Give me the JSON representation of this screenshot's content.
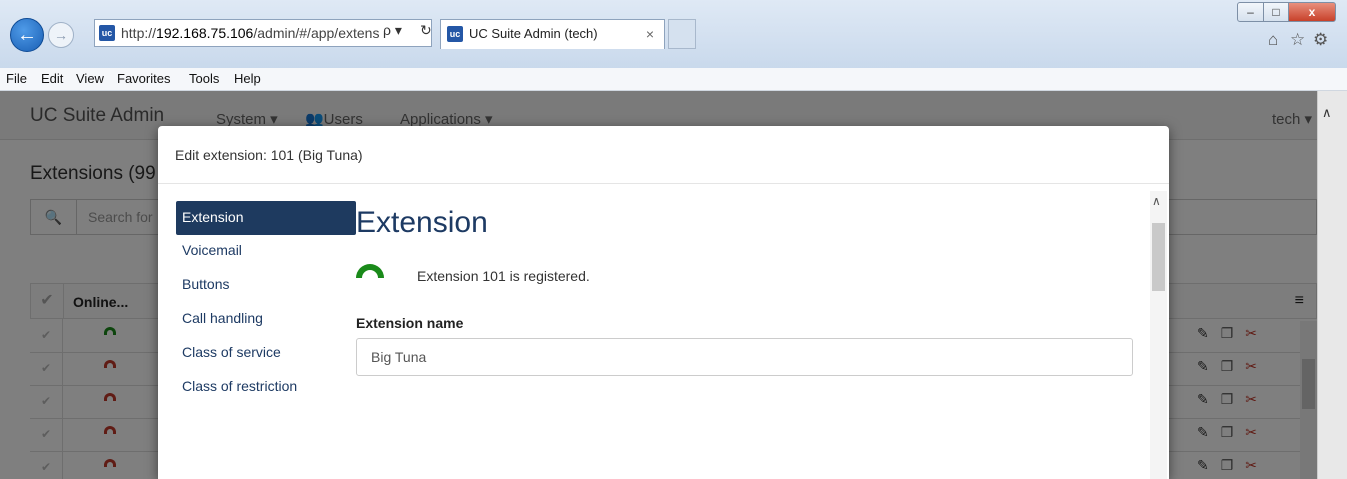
{
  "browser": {
    "url_prefix": "http://",
    "url_host": "192.168.75.106",
    "url_path": "/admin/#/app/extens",
    "search_glyph": "ρ ▾",
    "refresh_glyph": "↻",
    "tab_title": "UC Suite Admin (tech)",
    "tab_close": "×",
    "back_glyph": "←",
    "forward_glyph": "→",
    "home_glyph": "⌂",
    "favorites_glyph": "☆",
    "tools_glyph": "⚙",
    "min_glyph": "–",
    "max_glyph": "□",
    "close_glyph": "x",
    "favicon_text": "uc",
    "menu": [
      "File",
      "Edit",
      "View",
      "Favorites",
      "Tools",
      "Help"
    ]
  },
  "app": {
    "brand": "UC Suite Admin",
    "nav": [
      "System ▾",
      "👥Users",
      "Applications ▾"
    ],
    "user": "tech ▾",
    "page_title": "Extensions (99",
    "search_icon": "🔍",
    "search_placeholder": "Search for",
    "table_header_online": "Online...",
    "table_menu": "≡",
    "check_glyph": "✔",
    "rows": [
      {
        "status": "registered",
        "status_color": "#1a8a1a"
      },
      {
        "status": "unregistered",
        "status_color": "#c0392b"
      },
      {
        "status": "unregistered",
        "status_color": "#c0392b"
      },
      {
        "status": "unregistered",
        "status_color": "#c0392b"
      },
      {
        "status": "unregistered",
        "status_color": "#c0392b"
      }
    ],
    "row_actions": {
      "edit": "✎",
      "copy": "❐",
      "delete": "✂"
    }
  },
  "modal": {
    "title": "Edit extension: 101 (Big Tuna)",
    "nav": [
      "Extension",
      "Voicemail",
      "Buttons",
      "Call handling",
      "Class of service",
      "Class of restriction"
    ],
    "active_nav": "Extension",
    "content_title": "Extension",
    "registration_text": "Extension 101 is registered.",
    "extension_name_label": "Extension name",
    "extension_name_value": "Big Tuna",
    "scroll_up_glyph": "∧"
  },
  "colors": {
    "accent": "#1e3a5f",
    "registered": "#1a8a1a",
    "unregistered": "#c0392b"
  }
}
